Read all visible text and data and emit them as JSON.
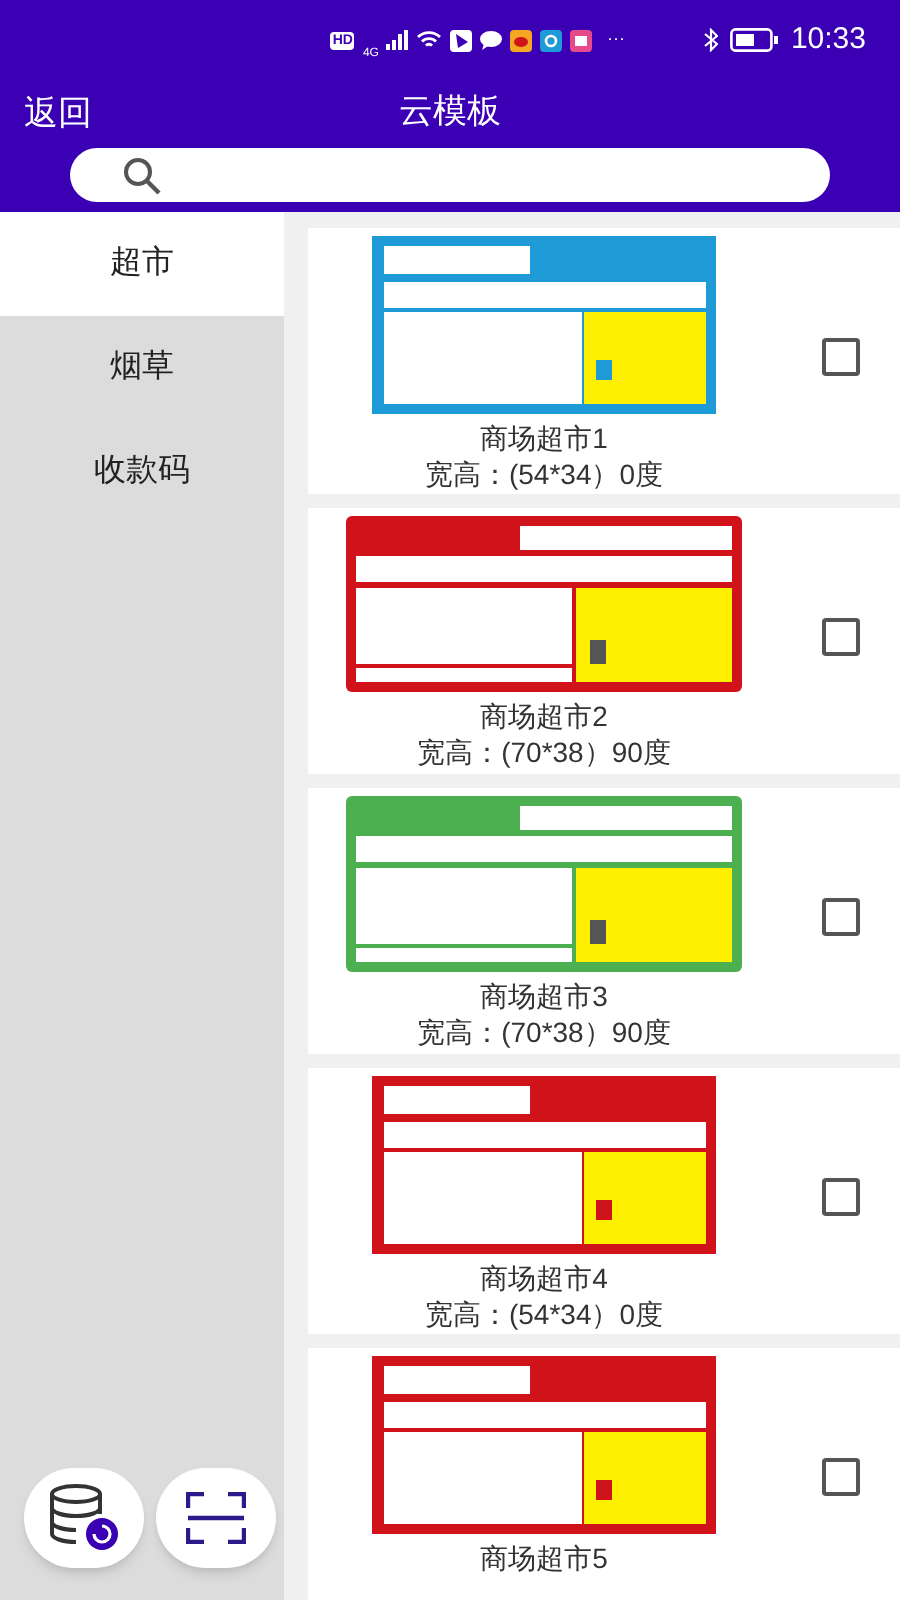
{
  "status_bar": {
    "network_badge": "HD",
    "network_type": "4G",
    "time": "10:33",
    "more": "···"
  },
  "header": {
    "back": "返回",
    "title": "云模板"
  },
  "sidebar": {
    "items": [
      {
        "label": "超市",
        "selected": true
      },
      {
        "label": "烟草",
        "selected": false
      },
      {
        "label": "收款码",
        "selected": false
      }
    ]
  },
  "templates": [
    {
      "kind": "compact",
      "color": "#1e9ad6",
      "name": "商场超市1",
      "size": "宽高：(54*34）0度",
      "checked": false
    },
    {
      "kind": "wide",
      "color": "#d0121b",
      "name": "商场超市2",
      "size": "宽高：(70*38）90度",
      "checked": false
    },
    {
      "kind": "wide",
      "color": "#4caf50",
      "name": "商场超市3",
      "size": "宽高：(70*38）90度",
      "checked": false
    },
    {
      "kind": "compact",
      "color": "#d0121b",
      "name": "商场超市4",
      "size": "宽高：(54*34）0度",
      "checked": false
    },
    {
      "kind": "compact",
      "color": "#d0121b",
      "name": "商场超市5",
      "checked": false
    }
  ]
}
